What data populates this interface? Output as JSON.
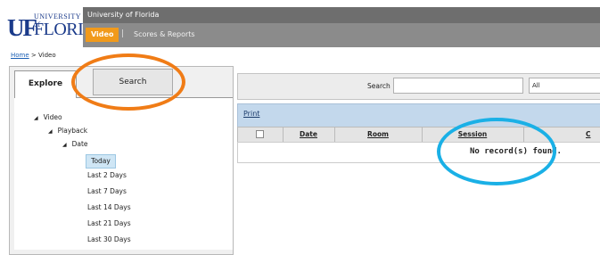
{
  "colors": {
    "accent": "#f19a1b",
    "header_dark": "#6e6e6e",
    "nav_bar": "#8b8b8b",
    "print_bar": "#c3d8ec",
    "annotation_orange": "#f07c16",
    "annotation_blue": "#1ab0e6"
  },
  "logo": {
    "uf": "UF",
    "university": "UNIVERSITY of",
    "florida": "FLORIDA"
  },
  "header": {
    "title": "University of Florida"
  },
  "nav": {
    "video": "Video",
    "separator": "|",
    "scores": "Scores & Reports"
  },
  "breadcrumb": {
    "home": "Home",
    "separator": ">",
    "current": "Video"
  },
  "tabs": {
    "explore": "Explore",
    "search": "Search"
  },
  "tree": {
    "video": "Video",
    "playback": "Playback",
    "date": "Date",
    "items": [
      "Today",
      "Last 2 Days",
      "Last 7 Days",
      "Last 14 Days",
      "Last 21 Days",
      "Last 30 Days"
    ]
  },
  "search": {
    "label": "Search",
    "value": "",
    "filter": "All"
  },
  "print": {
    "label": "Print"
  },
  "table": {
    "columns": [
      "Date",
      "Room",
      "Session",
      "C"
    ],
    "empty": "No record(s) found."
  }
}
